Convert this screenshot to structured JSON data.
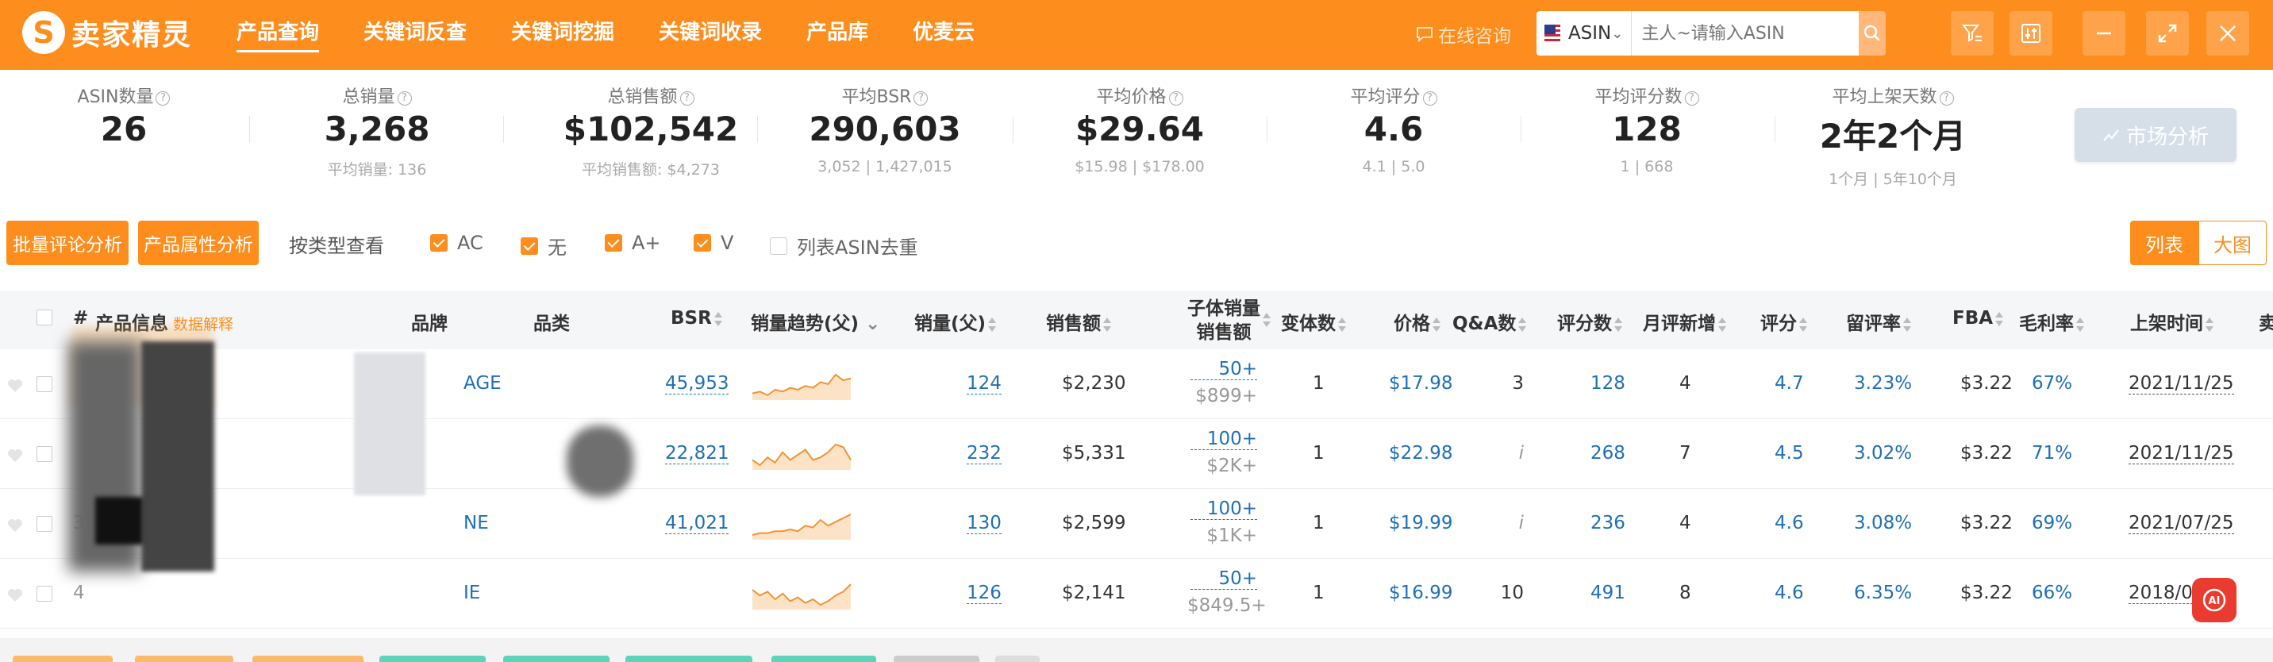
{
  "brand": {
    "name": "卖家精灵",
    "logo_letter": "S"
  },
  "nav": [
    "产品查询",
    "关键词反查",
    "关键词挖掘",
    "关键词收录",
    "产品库",
    "优麦云"
  ],
  "consult": "在线咨询",
  "search": {
    "site": "ASIN",
    "placeholder": "主人~请输入ASIN"
  },
  "stats": [
    {
      "label": "ASIN数量",
      "value": "26",
      "sub": ""
    },
    {
      "label": "总销量",
      "value": "3,268",
      "sub": "平均销量: 136"
    },
    {
      "label": "总销售额",
      "value": "$102,542",
      "sub": "平均销售额: $4,273"
    },
    {
      "label": "平均BSR",
      "value": "290,603",
      "sub": "3,052 | 1,427,015"
    },
    {
      "label": "平均价格",
      "value": "$29.64",
      "sub": "$15.98 | $178.00"
    },
    {
      "label": "平均评分",
      "value": "4.6",
      "sub": "4.1 | 5.0"
    },
    {
      "label": "平均评分数",
      "value": "128",
      "sub": "1 | 668"
    },
    {
      "label": "平均上架天数",
      "value": "2年2个月",
      "sub": "1个月 | 5年10个月"
    }
  ],
  "market_button": "市场分析",
  "filters": {
    "batch_review": "批量评论分析",
    "attr_analysis": "产品属性分析",
    "by_type": "按类型查看",
    "checks": [
      {
        "label": "AC",
        "checked": true
      },
      {
        "label": "无",
        "checked": true
      },
      {
        "label": "A+",
        "checked": true
      },
      {
        "label": "V",
        "checked": true
      }
    ],
    "dedupe": {
      "label": "列表ASIN去重",
      "checked": false
    },
    "view_list": "列表",
    "view_big": "大图"
  },
  "table": {
    "headers": {
      "num": "#",
      "product": "产品信息",
      "data_explain": "数据解释",
      "brand": "品牌",
      "category": "品类",
      "bsr": "BSR",
      "trend": "销量趋势(父)",
      "sales": "销量(父)",
      "revenue": "销售额",
      "child_line1": "子体销量",
      "child_line2": "销售额",
      "variants": "变体数",
      "price": "价格",
      "qa": "Q&A数",
      "reviews": "评分数",
      "monthly_new": "月评新增",
      "rating": "评分",
      "retention": "留评率",
      "fba": "FBA",
      "margin": "毛利率",
      "launch": "上架时间",
      "extra": "卖"
    },
    "rows": [
      {
        "num": "",
        "brand": "AGE",
        "bsr": "45,953",
        "trend": [
          8,
          9,
          7,
          10,
          9,
          11,
          10,
          12,
          11,
          14,
          13,
          18,
          15,
          16
        ],
        "sales": "124",
        "revenue": "$2,230",
        "child_sales": "50+",
        "child_revenue": "$899+",
        "variants": "1",
        "price": "$17.98",
        "qa": "3",
        "reviews": "128",
        "monthly_new": "4",
        "rating": "4.7",
        "retention": "3.23%",
        "fba": "$3.22",
        "margin": "67%",
        "launch": "2021/11/25"
      },
      {
        "num": "",
        "brand": "",
        "bsr": "22,821",
        "trend": [
          12,
          10,
          13,
          11,
          15,
          12,
          14,
          16,
          12,
          13,
          15,
          18,
          17,
          12
        ],
        "sales": "232",
        "revenue": "$5,331",
        "child_sales": "100+",
        "child_revenue": "$2K+",
        "variants": "1",
        "price": "$22.98",
        "qa": "i",
        "reviews": "268",
        "monthly_new": "7",
        "rating": "4.5",
        "retention": "3.02%",
        "fba": "$3.22",
        "margin": "71%",
        "launch": "2021/11/25"
      },
      {
        "num": "3",
        "brand": "NE",
        "bsr": "41,021",
        "trend": [
          8,
          9,
          9,
          10,
          10,
          11,
          10,
          13,
          12,
          16,
          13,
          15,
          17,
          19
        ],
        "sales": "130",
        "revenue": "$2,599",
        "child_sales": "100+",
        "child_revenue": "$1K+",
        "variants": "1",
        "price": "$19.99",
        "qa": "i",
        "reviews": "236",
        "monthly_new": "4",
        "rating": "4.6",
        "retention": "3.08%",
        "fba": "$3.22",
        "margin": "69%",
        "launch": "2021/07/25"
      },
      {
        "num": "4",
        "brand": "IE",
        "bsr": "",
        "trend": [
          16,
          13,
          15,
          11,
          14,
          10,
          12,
          9,
          11,
          8,
          10,
          13,
          15,
          19
        ],
        "sales": "126",
        "revenue": "$2,141",
        "child_sales": "50+",
        "child_revenue": "$849.5+",
        "variants": "1",
        "price": "$16.99",
        "qa": "10",
        "reviews": "491",
        "monthly_new": "8",
        "rating": "4.6",
        "retention": "6.35%",
        "fba": "$3.22",
        "margin": "66%",
        "launch": "2018/0"
      }
    ]
  },
  "colors": {
    "accent": "#fd8d1d",
    "link": "#1f6fb7",
    "ai": "#e93b2f"
  }
}
